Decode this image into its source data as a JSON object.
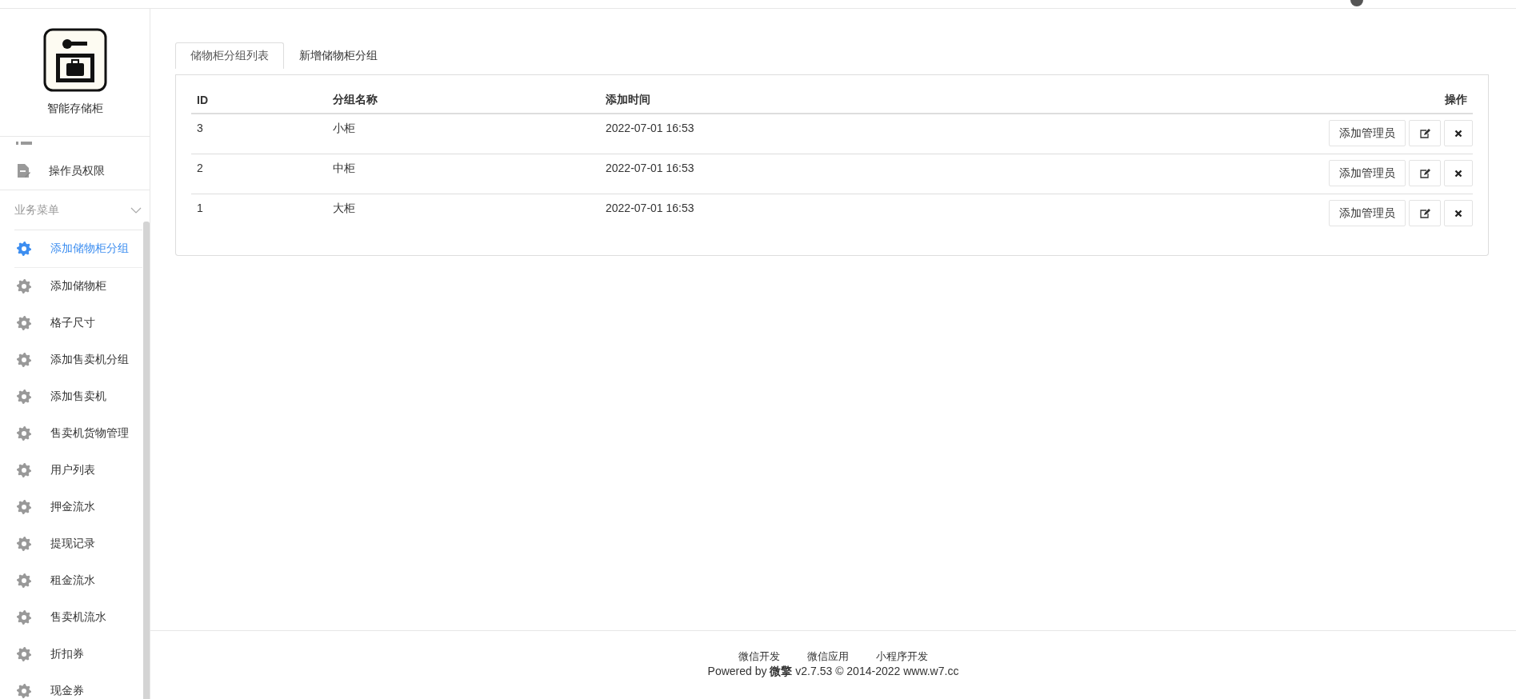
{
  "app": {
    "name": "智能存储柜"
  },
  "sidebar": {
    "items": [
      {
        "label": "操作员权限",
        "selected": false
      }
    ],
    "section": {
      "title": "业务菜单",
      "expanded": true
    },
    "menu": [
      {
        "label": "添加储物柜分组",
        "selected": true
      },
      {
        "label": "添加储物柜",
        "selected": false
      },
      {
        "label": "格子尺寸",
        "selected": false
      },
      {
        "label": "添加售卖机分组",
        "selected": false
      },
      {
        "label": "添加售卖机",
        "selected": false
      },
      {
        "label": "售卖机货物管理",
        "selected": false
      },
      {
        "label": "用户列表",
        "selected": false
      },
      {
        "label": "押金流水",
        "selected": false
      },
      {
        "label": "提现记录",
        "selected": false
      },
      {
        "label": "租金流水",
        "selected": false
      },
      {
        "label": "售卖机流水",
        "selected": false
      },
      {
        "label": "折扣券",
        "selected": false
      },
      {
        "label": "现金券",
        "selected": false
      }
    ]
  },
  "tabs": [
    {
      "label": "储物柜分组列表",
      "selected": true
    },
    {
      "label": "新增储物柜分组",
      "selected": false
    }
  ],
  "table": {
    "columns": [
      "ID",
      "分组名称",
      "添加时间",
      "操作"
    ],
    "rows": [
      {
        "id": "3",
        "name": "小柜",
        "added": "2022-07-01 16:53",
        "action": "添加管理员"
      },
      {
        "id": "2",
        "name": "中柜",
        "added": "2022-07-01 16:53",
        "action": "添加管理员"
      },
      {
        "id": "1",
        "name": "大柜",
        "added": "2022-07-01 16:53",
        "action": "添加管理员"
      }
    ]
  },
  "footer": {
    "links": [
      "微信开发",
      "微信应用",
      "小程序开发"
    ],
    "powered": "Powered by **微擎** v2.7.53 © 2014-2022 www.w7.cc"
  }
}
